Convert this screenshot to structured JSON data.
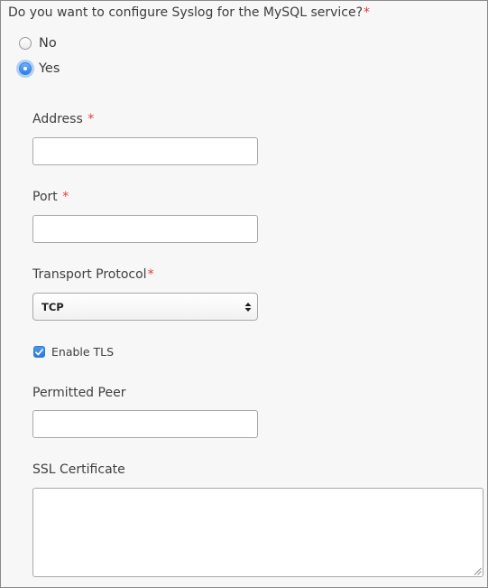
{
  "question": {
    "text": "Do you want to configure Syslog for the MySQL service?",
    "required_mark": "*"
  },
  "options": {
    "no_label": "No",
    "yes_label": "Yes",
    "selected": "Yes"
  },
  "address": {
    "label": "Address",
    "required_mark": "*",
    "value": ""
  },
  "port": {
    "label": "Port",
    "required_mark": "*",
    "value": ""
  },
  "transport": {
    "label": "Transport Protocol",
    "required_mark": "*",
    "selected": "TCP"
  },
  "tls": {
    "label": "Enable TLS",
    "checked": true
  },
  "permitted_peer": {
    "label": "Permitted Peer",
    "value": ""
  },
  "ssl_certificate": {
    "label": "SSL Certificate",
    "value": ""
  },
  "colors": {
    "required": "#e23b3b",
    "accent": "#2f7fe0",
    "background": "#f7f7f7"
  }
}
